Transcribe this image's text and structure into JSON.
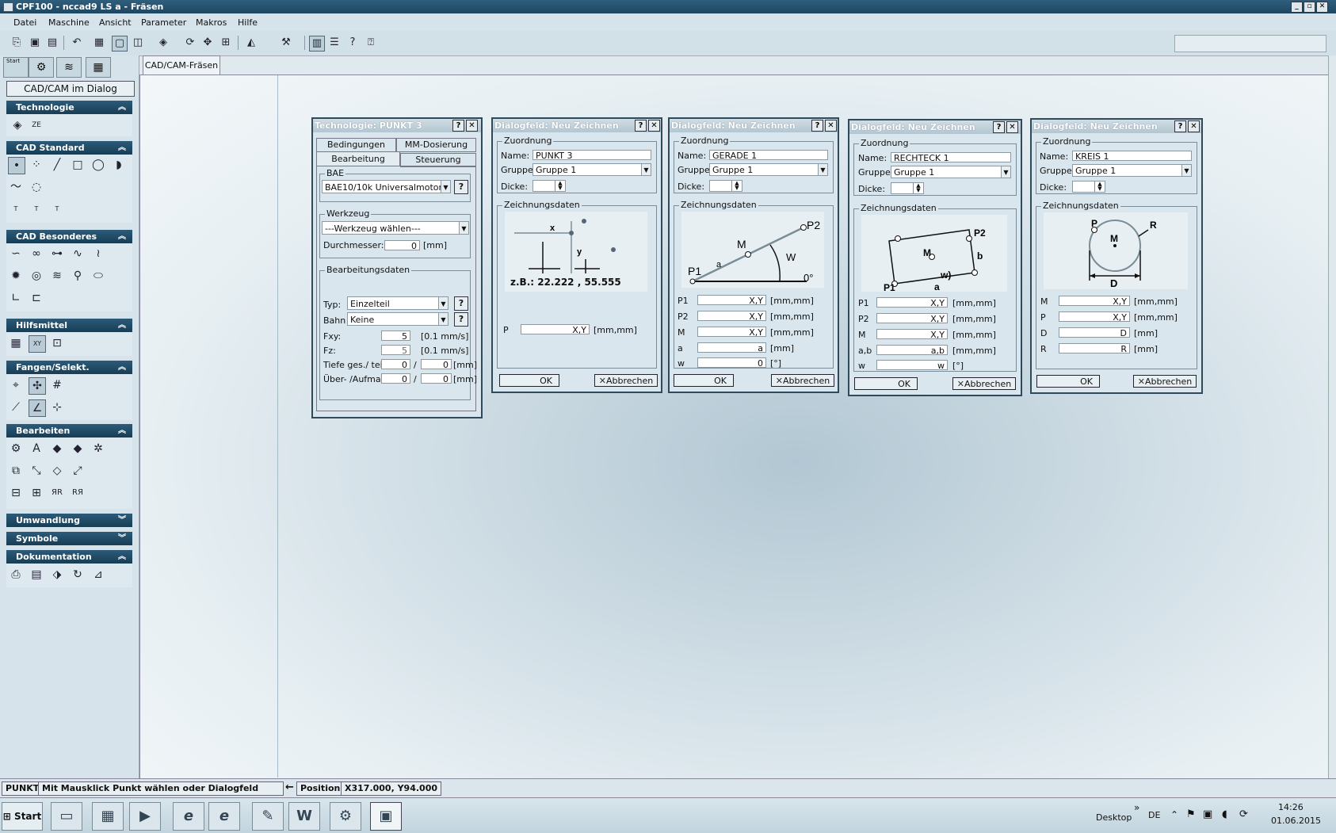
{
  "window": {
    "title": "CPF100 - nccad9 LS a - Fräsen",
    "min": "_",
    "max": "▫",
    "close": "✕"
  },
  "menu": [
    "Datei",
    "Maschine",
    "Ansicht",
    "Parameter",
    "Makros",
    "Hilfe"
  ],
  "left_tabs": [
    "Start",
    "⚙",
    "≋",
    "▦"
  ],
  "cad_dialog_button": "CAD/CAM im Dialog",
  "sections": {
    "technologie": "Technologie",
    "cad_standard": "CAD Standard",
    "cad_besonderes": "CAD Besonderes",
    "hilfsmittel": "Hilfsmittel",
    "fangen": "Fangen/Selekt.",
    "bearbeiten": "Bearbeiten",
    "umwandlung": "Umwandlung",
    "symbole": "Symbole",
    "dokumentation": "Dokumentation"
  },
  "doc_tab": "CAD/CAM-Fräsen",
  "tech_dialog": {
    "title": "Technologie:  PUNKT 3",
    "tabs": [
      "Bedingungen",
      "MM-Dosierung",
      "Bearbeitung",
      "Steuerung"
    ],
    "bae_label": "BAE",
    "bae_value": "BAE10/10k Universalmotor",
    "werkzeug_label": "Werkzeug",
    "werkzeug_value": "---Werkzeug wählen---",
    "durchmesser_label": "Durchmesser:",
    "durchmesser_value": "0",
    "durchmesser_unit": "[mm]",
    "bearbeitungsdaten_label": "Bearbeitungsdaten",
    "typ_label": "Typ:",
    "typ_value": "Einzelteil",
    "bahn_label": "Bahn",
    "bahn_value": "Keine",
    "fxy_label": "Fxy:",
    "fxy_value": "5",
    "fxy_unit": "[0.1 mm/s]",
    "fz_label": "Fz:",
    "fz_value": "5",
    "fz_unit": "[0.1 mm/s]",
    "tiefe_label": "Tiefe ges./ teil:",
    "tiefe_a": "0",
    "tiefe_b": "0",
    "tiefe_unit": "[mm]",
    "ueber_label": "Über- /Aufmaß:",
    "ueber_a": "0",
    "ueber_b": "0",
    "ueber_unit": "[mm]",
    "slash": "/",
    "q": "?"
  },
  "common": {
    "dlg_title": "Dialogfeld: Neu Zeichnen",
    "zuordnung": "Zuordnung",
    "name": "Name:",
    "gruppe": "Gruppe:",
    "dicke": "Dicke:",
    "gruppe_value": "Gruppe 1",
    "zeichnungsdaten": "Zeichnungsdaten",
    "ok": "OK",
    "abbrechen": "Abbrechen",
    "q": "?",
    "x": "✕"
  },
  "punkt_dialog": {
    "name_value": "PUNKT 3",
    "example": "z.B.: 22.222 , 55.555",
    "rows": [
      {
        "label": "P",
        "value": "X,Y",
        "unit": "[mm,mm]"
      }
    ]
  },
  "gerade_dialog": {
    "name_value": "GERADE 1",
    "rows": [
      {
        "label": "P1",
        "value": "X,Y",
        "unit": "[mm,mm]"
      },
      {
        "label": "P2",
        "value": "X,Y",
        "unit": "[mm,mm]"
      },
      {
        "label": "M",
        "value": "X,Y",
        "unit": "[mm,mm]"
      },
      {
        "label": "a",
        "value": "a",
        "unit": "[mm]"
      },
      {
        "label": "w",
        "value": "0",
        "unit": "[°]"
      }
    ]
  },
  "rechteck_dialog": {
    "name_value": "RECHTECK 1",
    "rows": [
      {
        "label": "P1",
        "value": "X,Y",
        "unit": "[mm,mm]"
      },
      {
        "label": "P2",
        "value": "X,Y",
        "unit": "[mm,mm]"
      },
      {
        "label": "M",
        "value": "X,Y",
        "unit": "[mm,mm]"
      },
      {
        "label": "a,b",
        "value": "a,b",
        "unit": "[mm,mm]"
      },
      {
        "label": "w",
        "value": "w",
        "unit": "[°]"
      }
    ]
  },
  "kreis_dialog": {
    "name_value": "KREIS 1",
    "rows": [
      {
        "label": "M",
        "value": "X,Y",
        "unit": "[mm,mm]"
      },
      {
        "label": "P",
        "value": "X,Y",
        "unit": "[mm,mm]"
      },
      {
        "label": "D",
        "value": "D",
        "unit": "[mm]"
      },
      {
        "label": "R",
        "value": "R",
        "unit": "[mm]"
      }
    ]
  },
  "status": {
    "mode": "PUNKT",
    "message": "Mit Mausklick Punkt wählen oder Dialogfeld bedienen",
    "arrow": "←",
    "position_label": "Position",
    "position_value": "X317.000, Y94.000"
  },
  "taskbar": {
    "start": "Start",
    "desktop": "Desktop",
    "chevron": "»",
    "lang": "DE",
    "time": "14:26",
    "date": "01.06.2015"
  }
}
